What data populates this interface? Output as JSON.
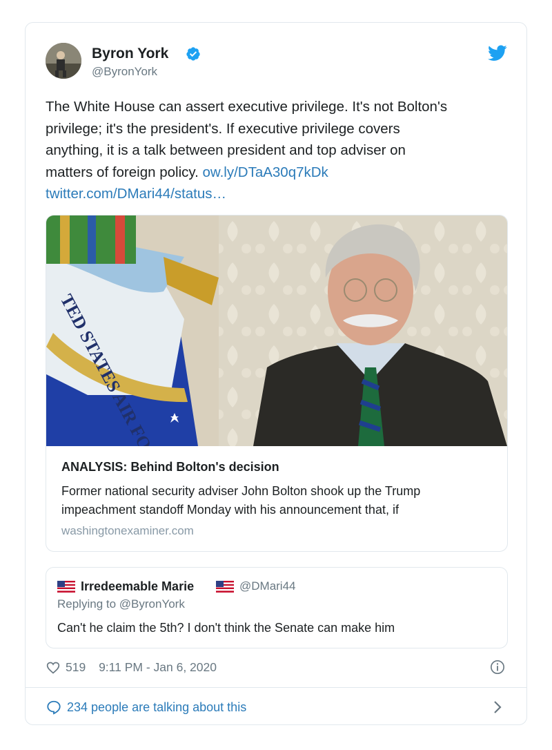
{
  "tweet": {
    "author_name": "Byron York",
    "author_handle": "@ByronYork",
    "text_lines": [
      "The White House can assert executive privilege. It's not Bolton's",
      "privilege; it's the president's. If executive privilege covers",
      "anything, it is a talk between president and top adviser on",
      "matters of foreign policy."
    ],
    "link_1": "ow.ly/DTaA30q7kDk",
    "link_2": "twitter.com/DMari44/status…"
  },
  "link_card": {
    "title": "ANALYSIS: Behind Bolton's decision",
    "description_1": "Former national security adviser John Bolton shook up the Trump",
    "description_2": "impeachment standoff Monday with his announcement that, if",
    "domain": "washingtonexaminer.com",
    "image_text": "TED STATES AIR FORCE"
  },
  "quoted_tweet": {
    "name": "Irredeemable Marie",
    "handle": "@DMari44",
    "replying_to": "Replying to @ByronYork",
    "text": "Can't he claim the 5th? I don't think the Senate can make him"
  },
  "footer": {
    "likes": "519",
    "timestamp": "9:11 PM - Jan 6, 2020",
    "talking": "234 people are talking about this"
  },
  "icons": {
    "verified": "verified-badge-icon",
    "twitter": "twitter-bird-icon",
    "heart": "heart-icon",
    "info": "info-icon",
    "reply": "speech-bubble-icon",
    "chevron": "chevron-right-icon",
    "flag": "us-flag-icon"
  },
  "colors": {
    "link": "#2b7bb9",
    "verified": "#1da1f2",
    "muted": "#697882",
    "border": "#e1e8ed"
  }
}
